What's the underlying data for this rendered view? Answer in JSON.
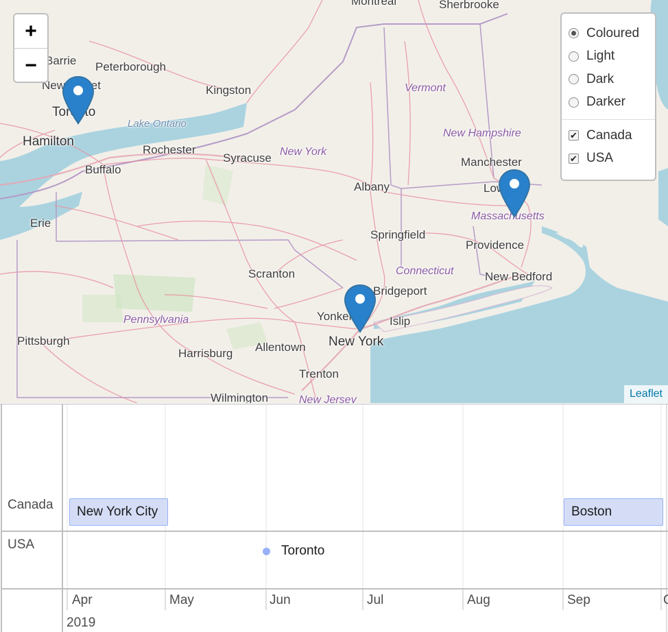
{
  "map": {
    "zoom_in": "+",
    "zoom_out": "−",
    "attribution": "Leaflet",
    "places": {
      "montreal": "Montreal",
      "sherbrooke": "Sherbrooke",
      "barrie": "Barrie",
      "peterborough": "Peterborough",
      "newmarket": "Newmarket",
      "kingston": "Kingston",
      "toronto": "Toronto",
      "hamilton": "Hamilton",
      "rochester": "Rochester",
      "syracuse": "Syracuse",
      "buffalo": "Buffalo",
      "manchester": "Manchester",
      "lowell": "Lowell",
      "albany": "Albany",
      "erie": "Erie",
      "springfield": "Springfield",
      "providence": "Providence",
      "scranton": "Scranton",
      "new_bedford": "New Bedford",
      "bridgeport": "Bridgeport",
      "yonkers": "Yonkers",
      "islip": "Islip",
      "new_york": "New York",
      "pittsburgh": "Pittsburgh",
      "harrisburg": "Harrisburg",
      "allentown": "Allentown",
      "trenton": "Trenton",
      "wilmington": "Wilmington"
    },
    "regions": {
      "vermont": "Vermont",
      "new_hampshire": "New Hampshire",
      "new_york_state": "New York",
      "massachusetts": "Massachusetts",
      "connecticut": "Connecticut",
      "pennsylvania": "Pennsylvania",
      "new_jersey": "New Jersey",
      "lake_ontario": "Lake Ontario"
    },
    "markers": [
      "marker-icon",
      "marker-icon",
      "marker-icon"
    ],
    "layers": {
      "base": [
        {
          "label": "Coloured",
          "selected": true
        },
        {
          "label": "Light",
          "selected": false
        },
        {
          "label": "Dark",
          "selected": false
        },
        {
          "label": "Darker",
          "selected": false
        }
      ],
      "overlays": [
        {
          "label": "Canada",
          "checked": true
        },
        {
          "label": "USA",
          "checked": true
        }
      ]
    }
  },
  "timeline": {
    "groups": [
      "Canada",
      "USA"
    ],
    "items": {
      "nyc": "New York City",
      "boston": "Boston",
      "toronto": "Toronto"
    },
    "months": [
      "Apr",
      "May",
      "Jun",
      "Jul",
      "Aug",
      "Sep",
      "O"
    ],
    "year": "2019",
    "colors": {
      "item_bg": "#d5ddf6",
      "item_border": "#97b0f8"
    }
  }
}
